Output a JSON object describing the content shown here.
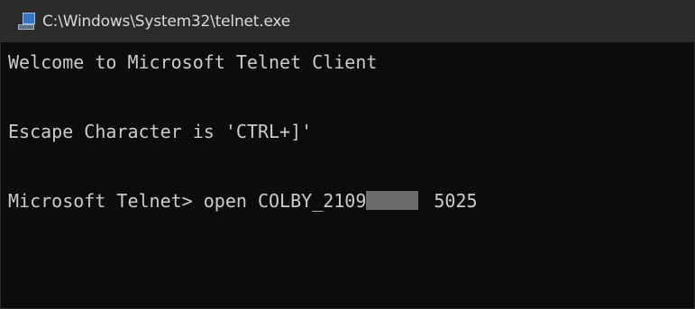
{
  "window": {
    "title": "C:\\Windows\\System32\\telnet.exe",
    "icon": "telnet-app-icon"
  },
  "console": {
    "lines": [
      "Welcome to Microsoft Telnet Client",
      "",
      "Escape Character is 'CTRL+]'",
      ""
    ],
    "prompt": "Microsoft Telnet>",
    "command": "open COLBY_2109",
    "port": "5025"
  },
  "colors": {
    "background": "#0c0c0c",
    "text": "#cccccc",
    "titlebar": "#2b2b2b",
    "redaction": "#6b6b6b"
  }
}
